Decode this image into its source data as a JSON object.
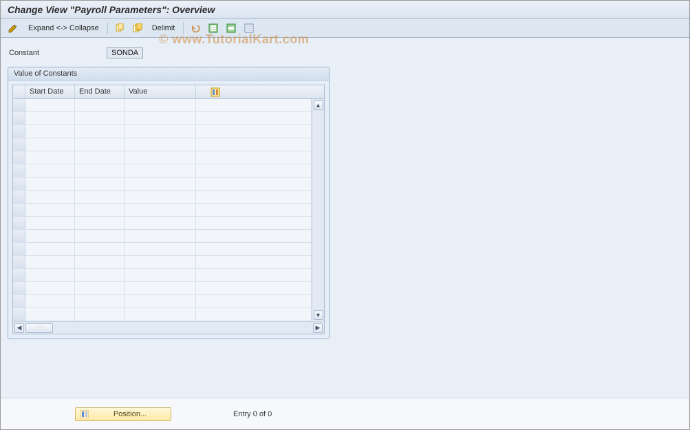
{
  "title": "Change View \"Payroll Parameters\": Overview",
  "toolbar": {
    "expand_collapse_label": "Expand <-> Collapse",
    "delimit_label": "Delimit"
  },
  "field": {
    "label": "Constant",
    "value": "SONDA"
  },
  "group": {
    "title": "Value of Constants",
    "columns": {
      "start": "Start Date",
      "end": "End Date",
      "value": "Value"
    },
    "row_count": 17
  },
  "footer": {
    "position_label": "Position...",
    "entry_text": "Entry 0 of 0"
  },
  "watermark": "© www.TutorialKart.com"
}
